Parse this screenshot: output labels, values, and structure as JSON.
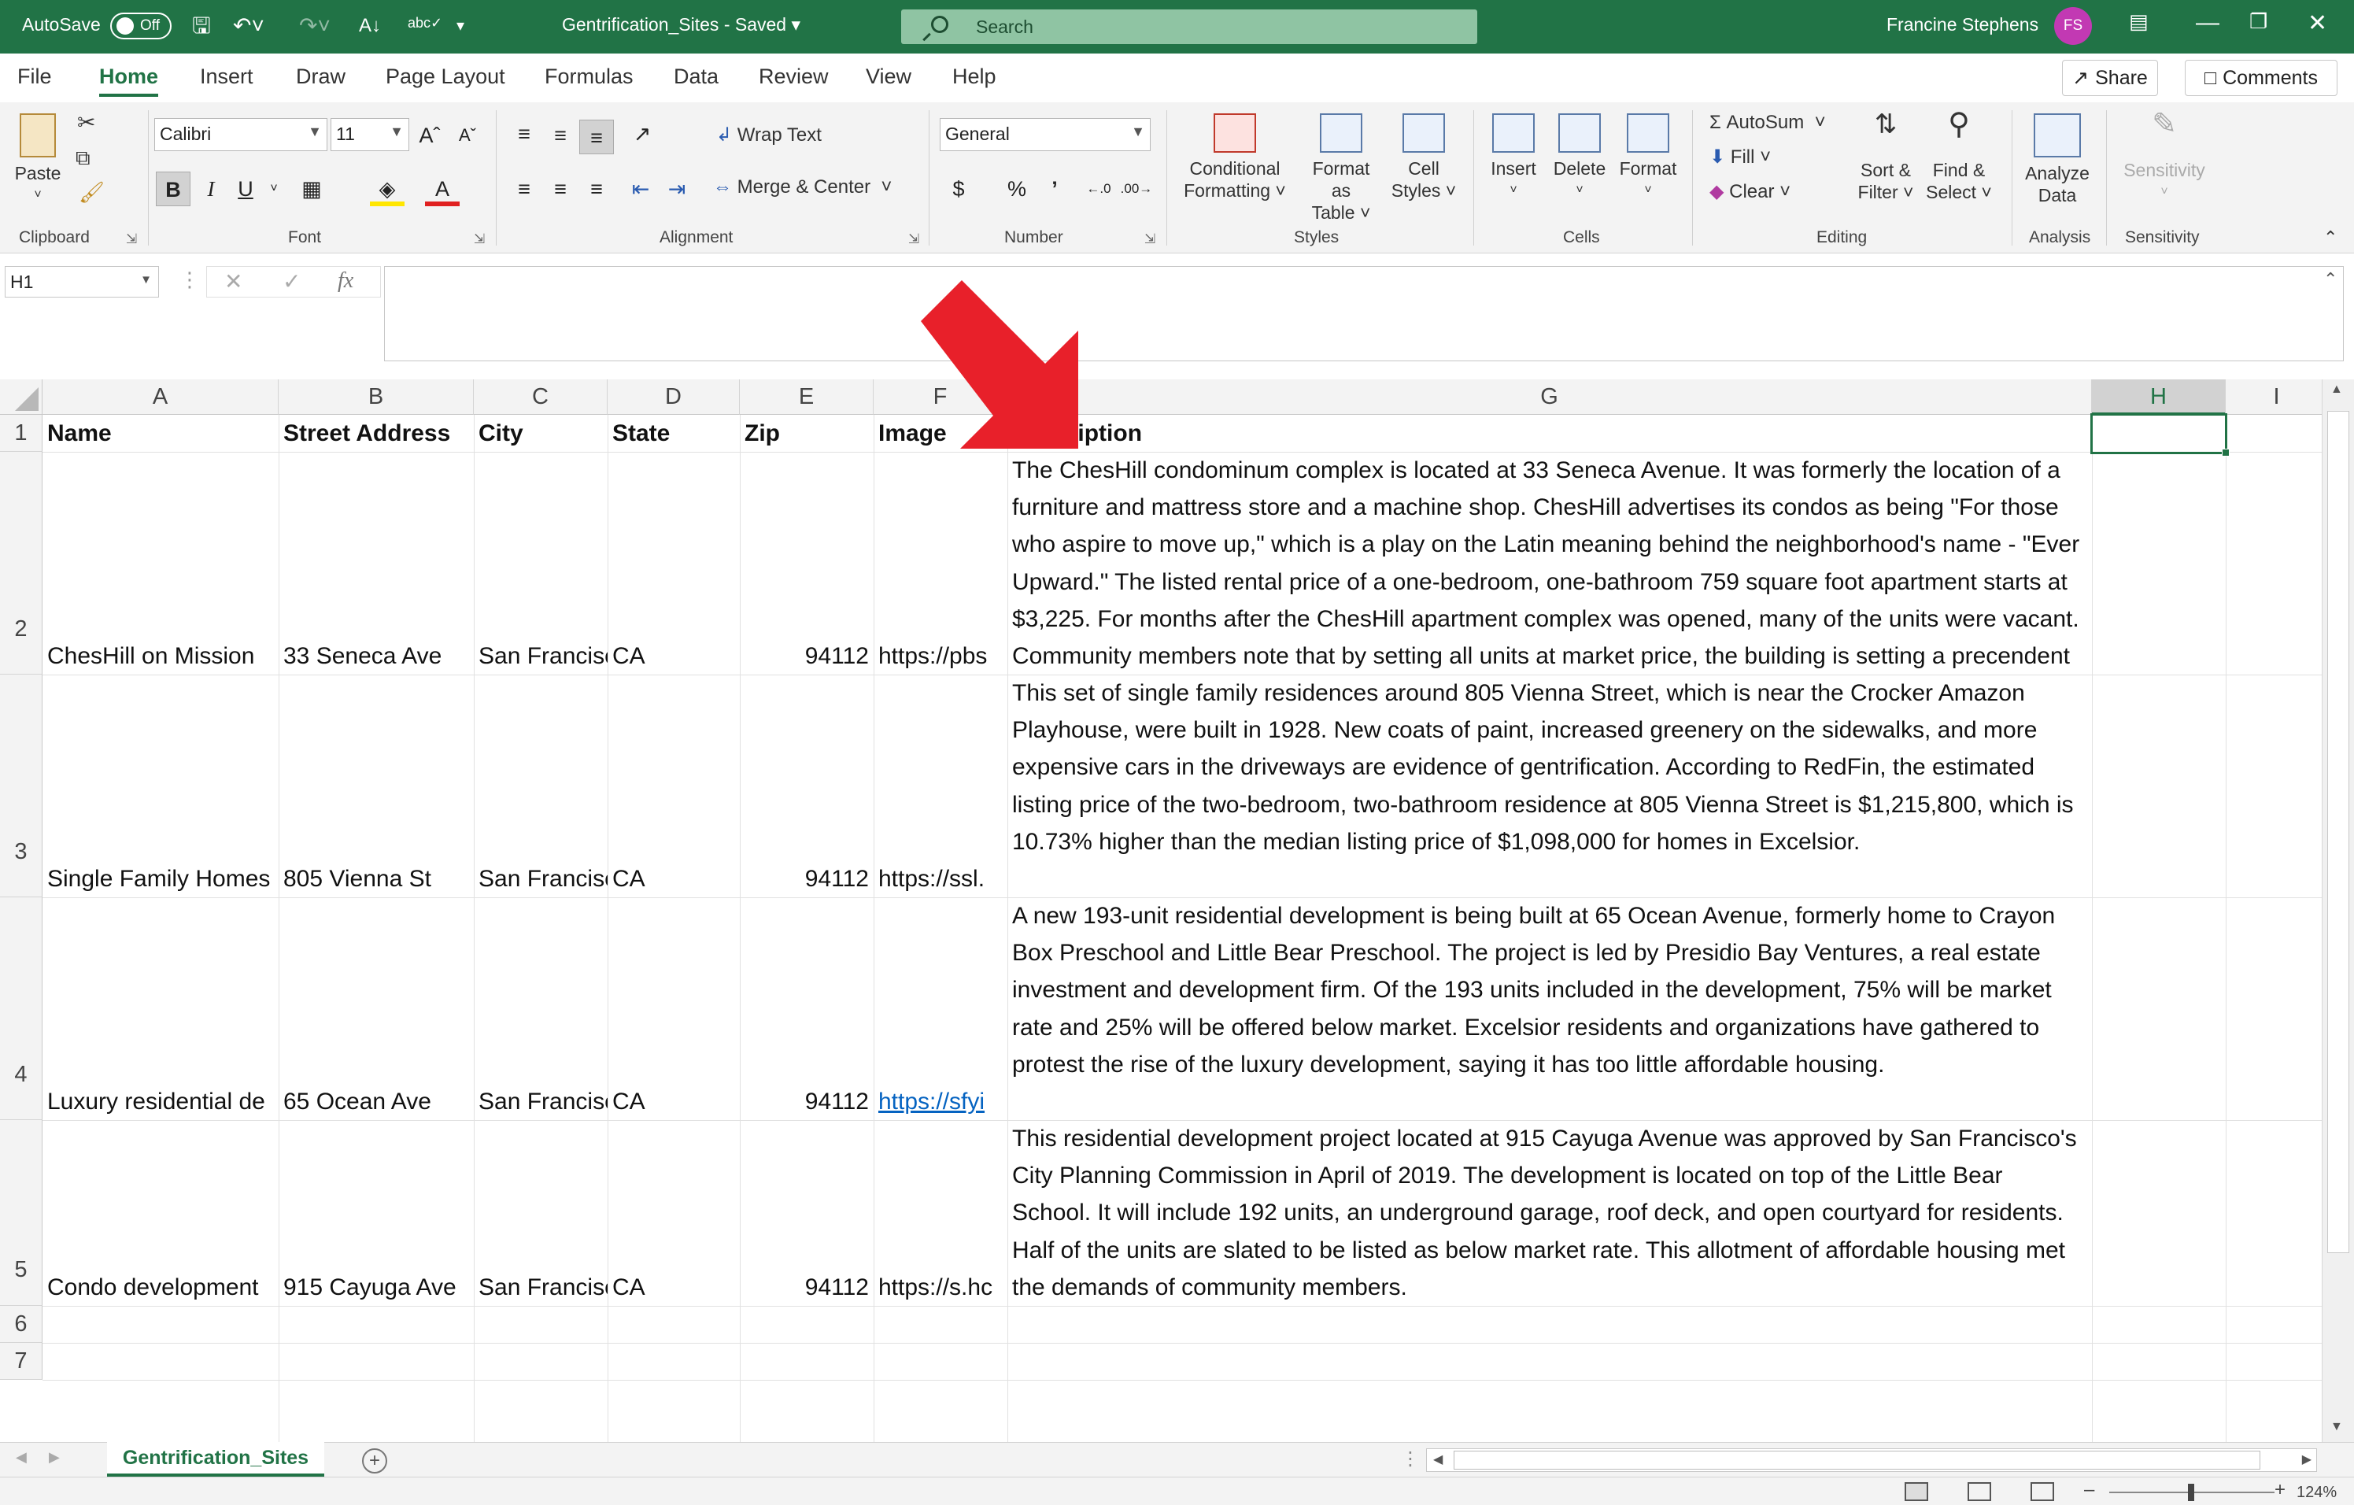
{
  "titlebar": {
    "autosave_label": "AutoSave",
    "autosave_state": "Off",
    "document_title": "Gentrification_Sites  -  Saved",
    "search_placeholder": "Search",
    "user_name": "Francine Stephens",
    "user_initials": "FS"
  },
  "menu": {
    "tabs": [
      "File",
      "Home",
      "Insert",
      "Draw",
      "Page Layout",
      "Formulas",
      "Data",
      "Review",
      "View",
      "Help"
    ],
    "active_tab": "Home",
    "share_label": "Share",
    "comments_label": "Comments"
  },
  "ribbon": {
    "clipboard": {
      "paste": "Paste",
      "group": "Clipboard"
    },
    "font": {
      "name": "Calibri",
      "size": "11",
      "bold": "B",
      "italic": "I",
      "underline": "U",
      "group": "Font"
    },
    "alignment": {
      "wrap_text": "Wrap Text",
      "merge_center": "Merge & Center",
      "group": "Alignment"
    },
    "number": {
      "format": "General",
      "currency": "$",
      "percent": "%",
      "comma": "’",
      "group": "Number"
    },
    "styles": {
      "conditional": "Conditional",
      "formatting": "Formatting",
      "format_as": "Format as",
      "table": "Table",
      "cell": "Cell",
      "styles": "Styles",
      "group": "Styles"
    },
    "cells": {
      "insert": "Insert",
      "delete": "Delete",
      "format": "Format",
      "group": "Cells"
    },
    "editing": {
      "autosum": "AutoSum",
      "fill": "Fill",
      "clear": "Clear",
      "sort": "Sort &",
      "filter": "Filter",
      "find": "Find &",
      "select": "Select",
      "group": "Editing"
    },
    "analysis": {
      "analyze": "Analyze",
      "data": "Data",
      "group": "Analysis"
    },
    "sensitivity": {
      "label": "Sensitivity",
      "group": "Sensitivity"
    }
  },
  "formula_bar": {
    "name_box": "H1",
    "cancel": "✕",
    "enter": "✓",
    "fx": "fx",
    "content": ""
  },
  "grid": {
    "columns": [
      "A",
      "B",
      "C",
      "D",
      "E",
      "F",
      "G",
      "H",
      "I"
    ],
    "selected_column": "H",
    "selected_cell": "H1",
    "row_numbers": [
      "1",
      "2",
      "3",
      "4",
      "5",
      "6",
      "7"
    ],
    "header": [
      "Name",
      "Street Address",
      "City",
      "State",
      "Zip",
      "Image",
      "Description"
    ],
    "rows": [
      {
        "name": "ChesHill on Mission",
        "street": "33 Seneca Ave",
        "city": "San Francisco",
        "state": "CA",
        "zip": "94112",
        "image": "https://pbs",
        "description": "The ChesHill condominum complex is located at 33 Seneca Avenue. It was formerly the location of a furniture and mattress store and a machine shop. ChesHill advertises its condos as being \"For those who aspire to move up,\" which is a play on the Latin meaning behind the neighborhood's name - \"Ever Upward.\" The listed rental price of a one-bedroom, one-bathroom 759 square foot apartment starts at $3,225. For months after the ChesHill apartment complex was opened, many of the units were vacant. Community members note that by setting all units at market price, the building is setting a precendent for new developments to be out of reach for neighborhood's working-class residents residents."
      },
      {
        "name": "Single Family Homes",
        "street": "805 Vienna St",
        "city": "San Francisco",
        "state": "CA",
        "zip": "94112",
        "image": "https://ssl.",
        "description": "This set of single family residences around 805 Vienna Street, which is near the Crocker Amazon Playhouse, were built in 1928. New coats of paint, increased greenery on the sidewalks, and more expensive cars in the driveways are evidence of gentrification. According to RedFin, the estimated listing price of the two-bedroom, two-bathroom residence at 805 Vienna Street is $1,215,800, which is 10.73% higher than the median listing price of $1,098,000 for homes in Excelsior."
      },
      {
        "name": "Luxury residential de",
        "street": "65 Ocean Ave",
        "city": "San Francisco",
        "state": "CA",
        "zip": "94112",
        "image": "https://sfyi",
        "description": "A new 193-unit residential development is being built at 65 Ocean Avenue, formerly home to Crayon Box Preschool and Little Bear Preschool. The project is led by Presidio Bay Ventures, a real estate investment and development firm. Of the 193 units included in the development, 75% will be market rate and 25% will be offered below market. Excelsior residents and organizations have gathered to protest the rise of the luxury development, saying it has too little affordable housing."
      },
      {
        "name": "Condo development",
        "street": "915 Cayuga Ave",
        "city": "San Francisco",
        "state": "CA",
        "zip": "94112",
        "image": "https://s.hc",
        "description": "This residential development project located at 915 Cayuga Avenue was approved by San Francisco's City Planning Commission in April of 2019. The development is located on top of the Little Bear School. It will include 192 units, an underground garage, roof deck, and open courtyard for residents. Half of the units are slated to be listed as below market rate. This allotment of affordable housing met the demands of community members."
      }
    ]
  },
  "sheets": {
    "active": "Gentrification_Sites"
  },
  "status": {
    "zoom": "124%"
  },
  "colors": {
    "excel_green": "#217346",
    "arrow_red": "#e8202a",
    "link_blue": "#0563c1"
  }
}
